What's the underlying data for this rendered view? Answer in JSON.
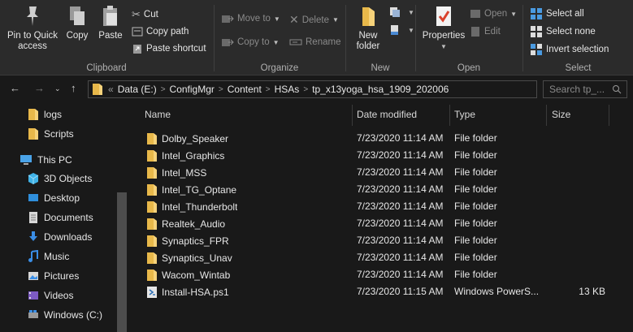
{
  "ribbon": {
    "clipboard": {
      "label": "Clipboard",
      "pin_label": "Pin to Quick access",
      "copy_label": "Copy",
      "paste_label": "Paste",
      "cut_label": "Cut",
      "copy_path_label": "Copy path",
      "paste_shortcut_label": "Paste shortcut"
    },
    "organize": {
      "label": "Organize",
      "move_to_label": "Move to",
      "copy_to_label": "Copy to",
      "delete_label": "Delete",
      "rename_label": "Rename"
    },
    "new": {
      "label": "New",
      "new_folder_label": "New folder"
    },
    "open": {
      "label": "Open",
      "properties_label": "Properties",
      "open_label": "Open",
      "edit_label": "Edit"
    },
    "select": {
      "label": "Select",
      "select_all_label": "Select all",
      "select_none_label": "Select none",
      "invert_selection_label": "Invert selection"
    }
  },
  "address": {
    "overflow": "«",
    "crumbs": [
      "Data (E:)",
      "ConfigMgr",
      "Content",
      "HSAs",
      "tp_x13yoga_hsa_1909_202006"
    ],
    "search_placeholder": "Search tp_..."
  },
  "sidebar": {
    "items": [
      {
        "label": "logs",
        "icon": "folder-icon"
      },
      {
        "label": "Scripts",
        "icon": "folder-icon"
      },
      {
        "label": "This PC",
        "icon": "pc-icon"
      },
      {
        "label": "3D Objects",
        "icon": "cube-icon"
      },
      {
        "label": "Desktop",
        "icon": "desktop-icon"
      },
      {
        "label": "Documents",
        "icon": "documents-icon"
      },
      {
        "label": "Downloads",
        "icon": "download-icon"
      },
      {
        "label": "Music",
        "icon": "music-icon"
      },
      {
        "label": "Pictures",
        "icon": "pictures-icon"
      },
      {
        "label": "Videos",
        "icon": "videos-icon"
      },
      {
        "label": "Windows (C:)",
        "icon": "drive-icon"
      }
    ]
  },
  "columns": {
    "name": "Name",
    "date": "Date modified",
    "type": "Type",
    "size": "Size"
  },
  "files": [
    {
      "name": "Dolby_Speaker",
      "date": "7/23/2020 11:14 AM",
      "type": "File folder",
      "size": ""
    },
    {
      "name": "Intel_Graphics",
      "date": "7/23/2020 11:14 AM",
      "type": "File folder",
      "size": ""
    },
    {
      "name": "Intel_MSS",
      "date": "7/23/2020 11:14 AM",
      "type": "File folder",
      "size": ""
    },
    {
      "name": "Intel_TG_Optane",
      "date": "7/23/2020 11:14 AM",
      "type": "File folder",
      "size": ""
    },
    {
      "name": "Intel_Thunderbolt",
      "date": "7/23/2020 11:14 AM",
      "type": "File folder",
      "size": ""
    },
    {
      "name": "Realtek_Audio",
      "date": "7/23/2020 11:14 AM",
      "type": "File folder",
      "size": ""
    },
    {
      "name": "Synaptics_FPR",
      "date": "7/23/2020 11:14 AM",
      "type": "File folder",
      "size": ""
    },
    {
      "name": "Synaptics_Unav",
      "date": "7/23/2020 11:14 AM",
      "type": "File folder",
      "size": ""
    },
    {
      "name": "Wacom_Wintab",
      "date": "7/23/2020 11:14 AM",
      "type": "File folder",
      "size": ""
    },
    {
      "name": "Install-HSA.ps1",
      "date": "7/23/2020 11:15 AM",
      "type": "Windows PowerS...",
      "size": "13 KB"
    }
  ]
}
